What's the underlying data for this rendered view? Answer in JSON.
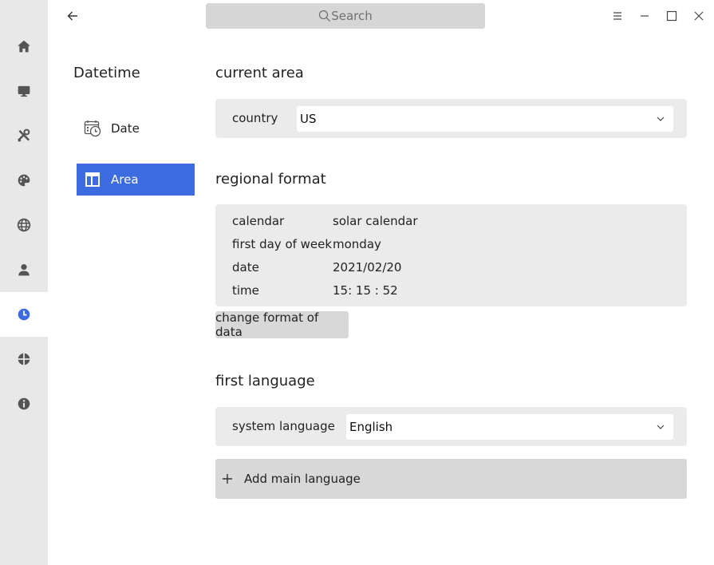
{
  "search": {
    "placeholder": "Search"
  },
  "rail": {
    "items": [
      {
        "icon": "home-icon"
      },
      {
        "icon": "monitor-icon"
      },
      {
        "icon": "tools-icon"
      },
      {
        "icon": "palette-icon"
      },
      {
        "icon": "globe-icon"
      },
      {
        "icon": "user-icon"
      },
      {
        "icon": "clock-icon",
        "active": true
      },
      {
        "icon": "update-icon"
      },
      {
        "icon": "info-icon"
      }
    ]
  },
  "nav": {
    "title": "Datetime",
    "items": [
      {
        "label": "Date",
        "icon": "calendar-clock-icon"
      },
      {
        "label": "Area",
        "icon": "layout-icon",
        "active": true
      }
    ]
  },
  "current_area": {
    "title": "current area",
    "country_label": "country",
    "country_value": "US"
  },
  "regional_format": {
    "title": "regional format",
    "rows": [
      {
        "key": "calendar",
        "value": "solar calendar"
      },
      {
        "key": "first day of week",
        "value": "monday"
      },
      {
        "key": "date",
        "value": "2021/02/20"
      },
      {
        "key": "time",
        "value": "15: 15 : 52"
      }
    ],
    "change_button": "change format of data"
  },
  "first_language": {
    "title": "first language",
    "system_language_label": "system language",
    "system_language_value": "English",
    "add_button": "Add main language"
  },
  "colors": {
    "accent": "#3d6be0",
    "rail_bg": "#e8e8e8",
    "panel_bg": "#ebebeb"
  }
}
